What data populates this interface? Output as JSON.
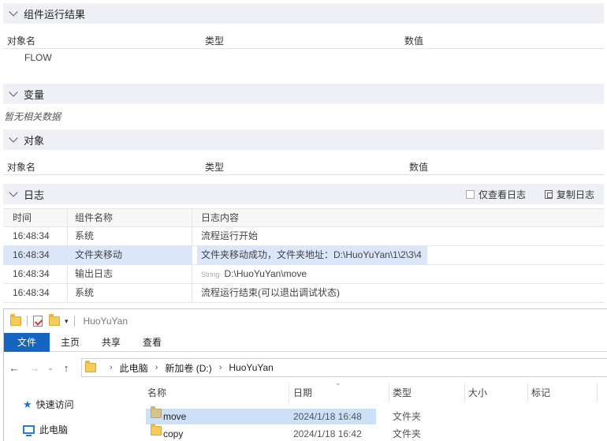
{
  "result_section": {
    "title": "组件运行结果",
    "columns": [
      "对象名",
      "类型",
      "数值"
    ],
    "rows": [
      {
        "name": "FLOW",
        "type": "",
        "value": ""
      }
    ]
  },
  "variables_section": {
    "title": "变量",
    "empty_text": "暂无相关数据"
  },
  "objects_section": {
    "title": "对象",
    "columns": [
      "对象名",
      "类型",
      "数值"
    ]
  },
  "log_section": {
    "title": "日志",
    "only_view_log": "仅查看日志",
    "copy_log": "复制日志",
    "columns": [
      "时间",
      "组件名称",
      "日志内容"
    ],
    "rows": [
      {
        "time": "16:48:34",
        "component": "系统",
        "tag": "",
        "content": "流程运行开始",
        "selected": false
      },
      {
        "time": "16:48:34",
        "component": "文件夹移动",
        "tag": "",
        "content": "文件夹移动成功，文件夹地址：D:\\HuoYuYan\\1\\2\\3\\4",
        "selected": true
      },
      {
        "time": "16:48:34",
        "component": "输出日志",
        "tag": "String",
        "content": "D:\\HuoYuYan\\move",
        "selected": false
      },
      {
        "time": "16:48:34",
        "component": "系统",
        "tag": "",
        "content": "流程运行结束(可以退出调试状态)",
        "selected": false
      }
    ]
  },
  "explorer": {
    "window_title": "HuoYuYan",
    "ribbon_tabs": [
      "文件",
      "主页",
      "共享",
      "查看"
    ],
    "breadcrumb": [
      "此电脑",
      "新加卷 (D:)",
      "HuoYuYan"
    ],
    "nav_items": [
      "快速访问",
      "此电脑"
    ],
    "columns": [
      "名称",
      "日期",
      "类型",
      "大小",
      "标记"
    ],
    "files": [
      {
        "name": "move",
        "date": "2024/1/18 16:48",
        "type": "文件夹",
        "selected": true
      },
      {
        "name": "copy",
        "date": "2024/1/18 16:42",
        "type": "文件夹",
        "selected": false
      }
    ]
  },
  "colors": {
    "section_header_bg": "#eef0f5",
    "selection": "#dbe6f8",
    "ribbon_file": "#1565c0",
    "folder": "#f5cc5a"
  }
}
